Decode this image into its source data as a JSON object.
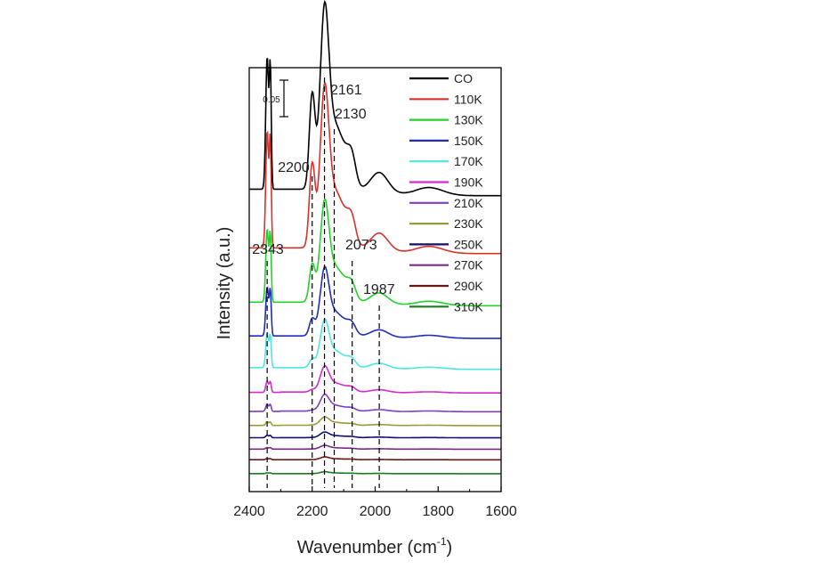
{
  "chart_data": {
    "type": "line",
    "xlabel": "Wavenumber (cm",
    "xlabel_superscript": "-1",
    "xlabel_suffix": ")",
    "ylabel": "Intensity (a.u.)",
    "xlim": [
      2400,
      1600
    ],
    "x_reversed": true,
    "x_ticks": [
      2400,
      2200,
      2000,
      1800,
      1600
    ],
    "y_ticks": [],
    "grid": false,
    "legend": "top-right",
    "scale_bar": {
      "label": "0.05",
      "value": 0.05
    },
    "peak_annotations": [
      {
        "label": "2343",
        "x": 2343
      },
      {
        "label": "2200",
        "x": 2200
      },
      {
        "label": "2161",
        "x": 2161
      },
      {
        "label": "2130",
        "x": 2130
      },
      {
        "label": "2073",
        "x": 2073
      },
      {
        "label": "1987",
        "x": 1987
      }
    ],
    "series": [
      {
        "name": "CO",
        "color": "#000000",
        "offset": 0.363,
        "peak_scale": 1.0
      },
      {
        "name": "110K",
        "color": "#d9312b",
        "offset": 0.292,
        "peak_scale": 0.88
      },
      {
        "name": "130K",
        "color": "#22d12a",
        "offset": 0.228,
        "peak_scale": 0.55
      },
      {
        "name": "150K",
        "color": "#1f2db8",
        "offset": 0.188,
        "peak_scale": 0.37
      },
      {
        "name": "170K",
        "color": "#4de6e0",
        "offset": 0.15,
        "peak_scale": 0.26
      },
      {
        "name": "190K",
        "color": "#d42ad0",
        "offset": 0.121,
        "peak_scale": 0.14
      },
      {
        "name": "210K",
        "color": "#7b3fc4",
        "offset": 0.098,
        "peak_scale": 0.09
      },
      {
        "name": "230K",
        "color": "#9a9a3a",
        "offset": 0.081,
        "peak_scale": 0.045
      },
      {
        "name": "250K",
        "color": "#101070",
        "offset": 0.066,
        "peak_scale": 0.03
      },
      {
        "name": "270K",
        "color": "#7a2a86",
        "offset": 0.052,
        "peak_scale": 0.02
      },
      {
        "name": "290K",
        "color": "#6b1414",
        "offset": 0.039,
        "peak_scale": 0.015
      },
      {
        "name": "310K",
        "color": "#1f7a1f",
        "offset": 0.022,
        "peak_scale": 0.01
      }
    ]
  }
}
